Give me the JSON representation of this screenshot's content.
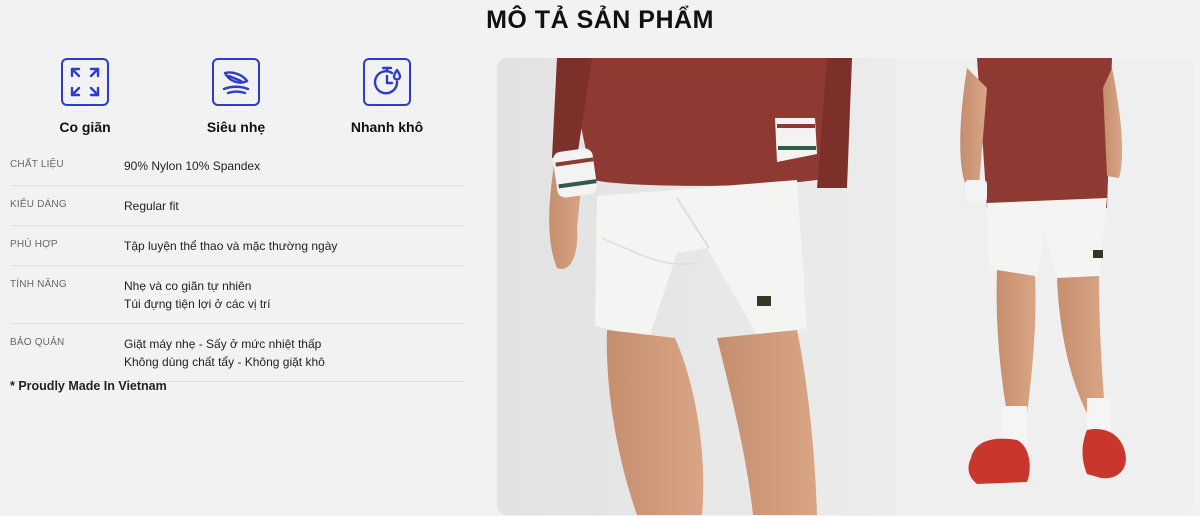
{
  "page": {
    "title": "MÔ TẢ SẢN PHẨM"
  },
  "features": [
    {
      "icon": "stretch-icon",
      "label": "Co giãn"
    },
    {
      "icon": "feather-light-icon",
      "label": "Siêu nhẹ"
    },
    {
      "icon": "quick-dry-timer-icon",
      "label": "Nhanh khô"
    }
  ],
  "specs": [
    {
      "key": "CHẤT LIỆU",
      "lines": [
        "90% Nylon 10% Spandex"
      ]
    },
    {
      "key": "KIỂU DÁNG",
      "lines": [
        "Regular fit"
      ]
    },
    {
      "key": "PHÙ HỢP",
      "lines": [
        "Tập luyện thể thao và mặc thường ngày"
      ]
    },
    {
      "key": "TÍNH NĂNG",
      "lines": [
        "Nhẹ và co giãn tự nhiên",
        "Túi đựng tiện lợi ở các vị trí"
      ]
    },
    {
      "key": "BẢO QUẢN",
      "lines": [
        "Giặt máy nhẹ - Sấy ở mức nhiệt thấp",
        "Không dùng chất tẩy - Không giặt khô"
      ]
    }
  ],
  "footer_note": "* Proudly Made In Vietnam",
  "colors": {
    "icon_accent": "#2f3bc9",
    "shirt": "#8e3a32",
    "shorts": "#f4f4f2",
    "shoe": "#c8362c"
  }
}
